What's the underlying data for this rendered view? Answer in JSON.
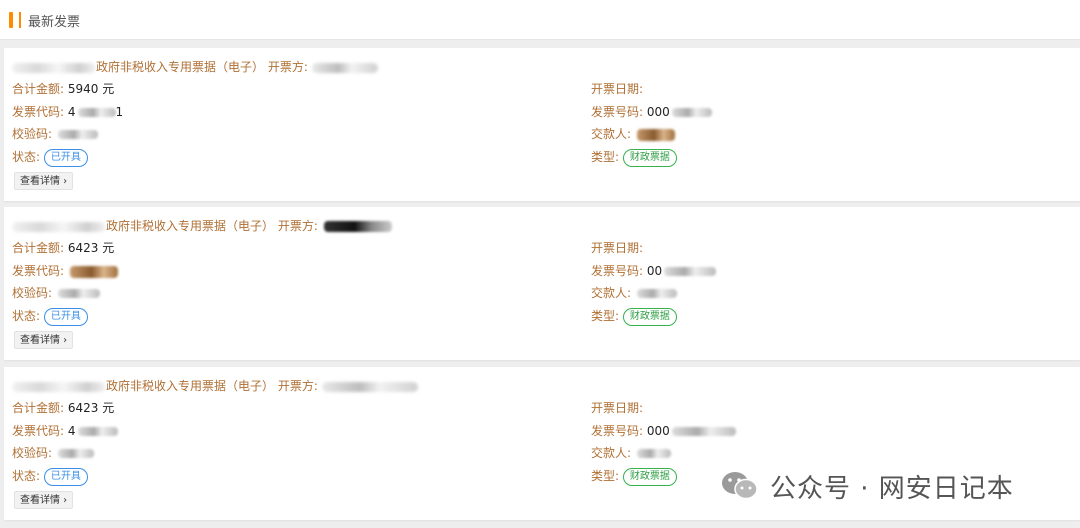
{
  "header": {
    "title": "最新发票"
  },
  "labels": {
    "invoice_type": "政府非税收入专用票据（电子）",
    "issuer": "开票方:",
    "total_amount": "合计金额:",
    "invoice_code": "发票代码:",
    "check_code": "校验码:",
    "status": "状态:",
    "issue_date": "开票日期:",
    "invoice_number": "发票号码:",
    "payer": "交款人:",
    "type": "类型:",
    "detail_button": "查看详情"
  },
  "invoices": [
    {
      "amount": "5940 元",
      "code_visible": "4",
      "code_suffix": "1",
      "number_visible": "000",
      "status": "已开具",
      "type": "财政票据"
    },
    {
      "amount": "6423 元",
      "code_visible": "",
      "code_suffix": "",
      "number_visible": "00",
      "status": "已开具",
      "type": "财政票据"
    },
    {
      "amount": "6423 元",
      "code_visible": "4",
      "code_suffix": "",
      "number_visible": "000",
      "status": "已开具",
      "type": "财政票据"
    }
  ],
  "watermark": {
    "text": "公众号 · 网安日记本",
    "icon": "wechat-icon"
  },
  "colors": {
    "accent": "#ff8c00",
    "label": "#b07035",
    "status_blue": "#3b8fe8",
    "type_green": "#2f9e44"
  }
}
